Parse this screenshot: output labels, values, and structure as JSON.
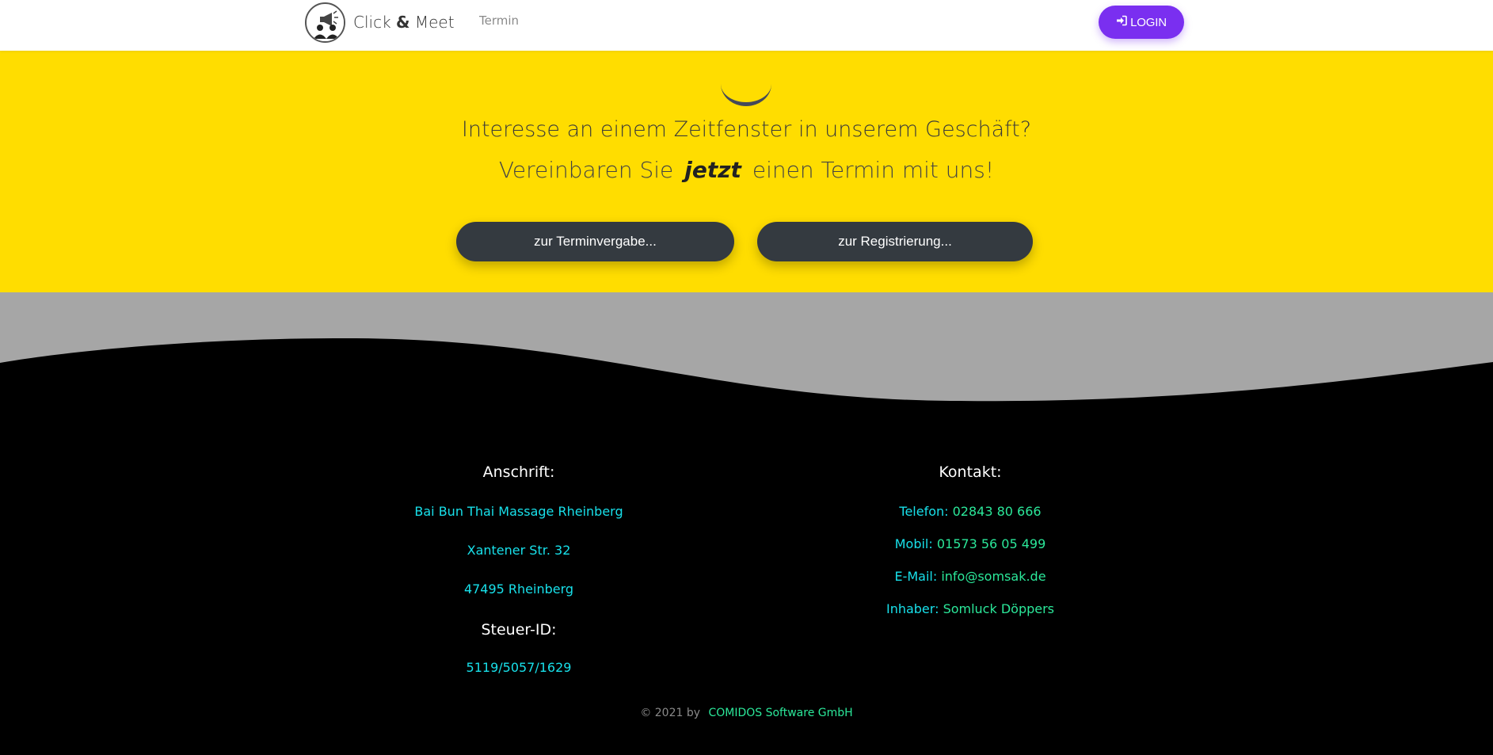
{
  "nav": {
    "brand_left": "Click",
    "brand_amp": "&",
    "brand_right": "Meet",
    "link_termin": "Termin",
    "login_label": "LOGIN"
  },
  "hero": {
    "title": "Interesse an einem Zeitfenster in unserem Geschäft?",
    "sub_pre": "Vereinbaren Sie",
    "sub_em": "jetzt",
    "sub_post": "einen Termin mit uns!",
    "btn_termin": "zur Terminvergabe...",
    "btn_register": "zur Registrierung..."
  },
  "footer": {
    "address_head": "Anschrift:",
    "address_lines": [
      "Bai Bun Thai Massage Rheinberg",
      "Xantener Str. 32",
      "47495 Rheinberg"
    ],
    "tax_head": "Steuer-ID:",
    "tax_id": "5119/5057/1629",
    "contact_head": "Kontakt:",
    "phone_label": "Telefon:",
    "phone": "02843 80 666",
    "mobile_label": "Mobil:",
    "mobile": "01573 56 05 499",
    "email_label": "E-Mail:",
    "email": "info@somsak.de",
    "owner_label": "Inhaber:",
    "owner": "Somluck Döppers",
    "copyright": "© 2021 by",
    "company": "COMIDOS Software GmbH"
  },
  "colors": {
    "hero_bg": "#ffdd00",
    "login_bg": "#7a2ff0",
    "button_dark": "#343a40",
    "footer_cyan": "#18e0ea",
    "footer_green": "#2be89a",
    "wave_gray": "#a6a6a6"
  }
}
